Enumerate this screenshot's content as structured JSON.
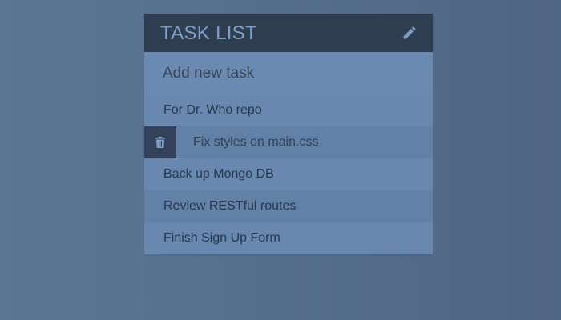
{
  "task_card": {
    "title": "TASK LIST",
    "edit_icon": "pencil-icon",
    "add_placeholder": "Add new task",
    "items": [
      {
        "label": "For Dr. Who repo",
        "completed": false
      },
      {
        "label": "Fix styles on main.css",
        "completed": true,
        "delete_icon": "trash-icon"
      },
      {
        "label": "Back up Mongo DB",
        "completed": false
      },
      {
        "label": "Review RESTful routes",
        "completed": false
      },
      {
        "label": "Finish Sign Up Form",
        "completed": false
      }
    ]
  },
  "colors": {
    "background": "#566e8e",
    "header": "#2f3d51",
    "accent": "#7f9fc7",
    "row_light": "#6888af",
    "row_dark": "#6281a7"
  }
}
